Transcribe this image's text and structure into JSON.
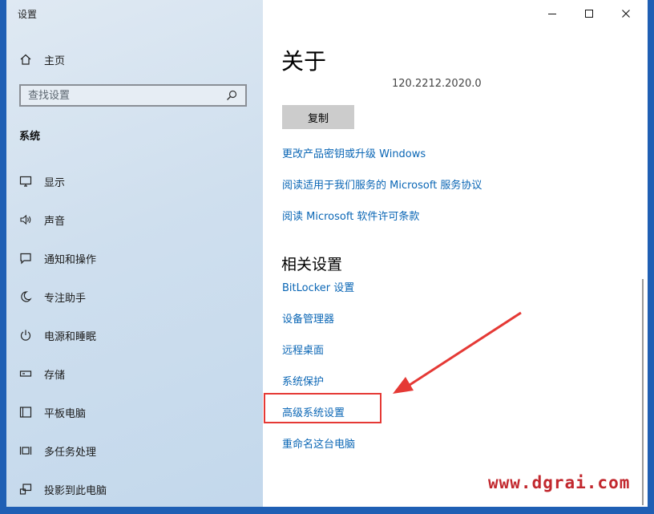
{
  "window": {
    "title": "设置",
    "controls": [
      "minimize",
      "maximize",
      "close"
    ]
  },
  "sidebar": {
    "home_label": "主页",
    "search_placeholder": "查找设置",
    "section_title": "系统",
    "items": [
      {
        "label": "显示",
        "icon": "monitor-icon"
      },
      {
        "label": "声音",
        "icon": "speaker-icon"
      },
      {
        "label": "通知和操作",
        "icon": "notification-icon"
      },
      {
        "label": "专注助手",
        "icon": "moon-icon"
      },
      {
        "label": "电源和睡眠",
        "icon": "power-icon"
      },
      {
        "label": "存储",
        "icon": "storage-icon"
      },
      {
        "label": "平板电脑",
        "icon": "tablet-icon"
      },
      {
        "label": "多任务处理",
        "icon": "multitask-icon"
      },
      {
        "label": "投影到此电脑",
        "icon": "project-icon"
      }
    ]
  },
  "main": {
    "title": "关于",
    "version": "120.2212.2020.0",
    "copy_button": "复制",
    "links": [
      "更改产品密钥或升级 Windows",
      "阅读适用于我们服务的 Microsoft 服务协议",
      "阅读 Microsoft 软件许可条款"
    ],
    "related_title": "相关设置",
    "related_links": [
      "BitLocker 设置",
      "设备管理器",
      "远程桌面",
      "系统保护",
      "高级系统设置",
      "重命名这台电脑"
    ]
  },
  "annotation": {
    "highlight_color": "#e53935",
    "highlighted_item": "高级系统设置"
  },
  "watermark": "www.dgrai.com",
  "colors": {
    "link": "#0a66b5",
    "accent_background": "#1f5fb4",
    "sidebar": "#cfdfee"
  }
}
